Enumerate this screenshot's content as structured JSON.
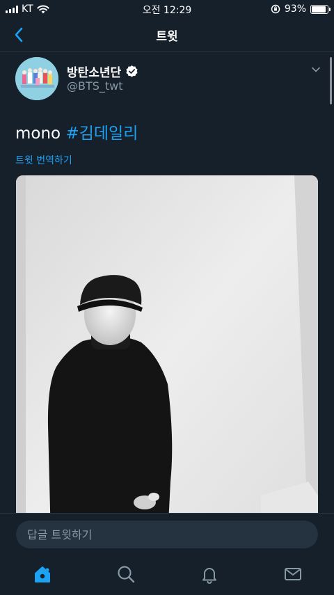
{
  "status_bar": {
    "carrier": "KT",
    "time": "오전 12:29",
    "battery_percent": "93%",
    "battery_level": 0.93
  },
  "nav": {
    "title": "트윗",
    "back_icon": "chevron-left-icon"
  },
  "tweet": {
    "display_name": "방탄소년단",
    "handle": "@BTS_twt",
    "verified": true,
    "text_plain": "mono ",
    "hashtag": "#김데일리",
    "translate_label": "트윗 번역하기"
  },
  "reply": {
    "placeholder": "답글 트윗하기"
  },
  "tab_bar": {
    "items": [
      {
        "icon": "home-icon",
        "active": true
      },
      {
        "icon": "search-icon",
        "active": false
      },
      {
        "icon": "bell-icon",
        "active": false
      },
      {
        "icon": "mail-icon",
        "active": false
      }
    ]
  },
  "colors": {
    "background": "#15202b",
    "accent": "#1da1f2",
    "secondary_text": "#8899a6",
    "input_bg": "#253341"
  }
}
